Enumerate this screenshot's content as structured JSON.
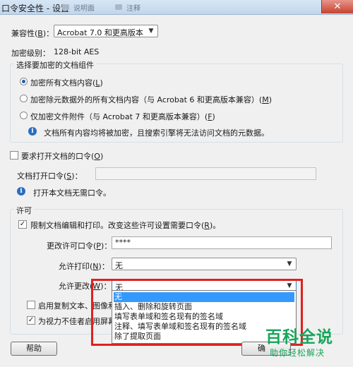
{
  "window": {
    "title": "口令安全性 - 设置",
    "ghost_tabs": [
      "说明面",
      "注释"
    ],
    "close_symbol": "✕"
  },
  "compatibility": {
    "label": "兼容性(",
    "mnemonic": "B",
    "label_end": ")：",
    "value": "Acrobat 7.0 和更高版本"
  },
  "encryption_level": {
    "label": "加密级别：",
    "value": "128-bit AES"
  },
  "components_group": {
    "title": "选择要加密的文档组件",
    "options": [
      {
        "label": "加密所有文档内容(",
        "mnemonic": "L",
        "end": ")",
        "selected": true
      },
      {
        "label": "加密除元数据外的所有文档内容（与 Acrobat 6 和更高版本兼容）(",
        "mnemonic": "M",
        "end": ")",
        "selected": false
      },
      {
        "label": "仅加密文件附件（与 Acrobat 7 和更高版本兼容）(",
        "mnemonic": "F",
        "end": ")",
        "selected": false
      }
    ],
    "info_text": "文档所有内容均将被加密，且搜索引擎将无法访问文档的元数据。"
  },
  "open_password": {
    "checkbox_label": "要求打开文档的口令(",
    "mnemonic": "O",
    "end": ")",
    "checked": false,
    "field_label": "文档打开口令(",
    "field_mnemonic": "S",
    "field_end": ")：",
    "field_value": "",
    "info_text": "打开本文档无需口令。"
  },
  "permissions": {
    "group_title": "许可",
    "restrict_label": "限制文档编辑和打印。改变这些许可设置需要口令(",
    "restrict_mnemonic": "R",
    "restrict_end": ")。",
    "restrict_checked": true,
    "change_pw_label": "更改许可口令(",
    "change_pw_mnemonic": "P",
    "change_pw_end": ")：",
    "change_pw_value": "****",
    "print_label": "允许打印(",
    "print_mnemonic": "N",
    "print_end": ")：",
    "print_value": "无",
    "changes_label": "允许更改(",
    "changes_mnemonic": "W",
    "changes_end": ")：",
    "changes_value": "无",
    "changes_options": [
      "无",
      "插入、删除和旋转页面",
      "填写表单域和签名现有的签名域",
      "注释、填写表单域和签名现有的签名域",
      "除了提取页面"
    ],
    "changes_selected_index": 0,
    "copy_label": "启用复制文本、图像和其",
    "copy_checked": false,
    "screen_reader_label": "为视力不佳者启用屏幕阅",
    "screen_reader_checked": true
  },
  "buttons": {
    "help": "帮助",
    "ok_partial": "确"
  },
  "watermark": {
    "main": "百科全说",
    "sub": "助你轻松解决"
  },
  "icons": {
    "check": "✓",
    "arrow": "▼",
    "info": "i"
  },
  "colors": {
    "selection": "#3399ff",
    "highlight_box": "#e02020",
    "watermark": "#19a55b"
  }
}
